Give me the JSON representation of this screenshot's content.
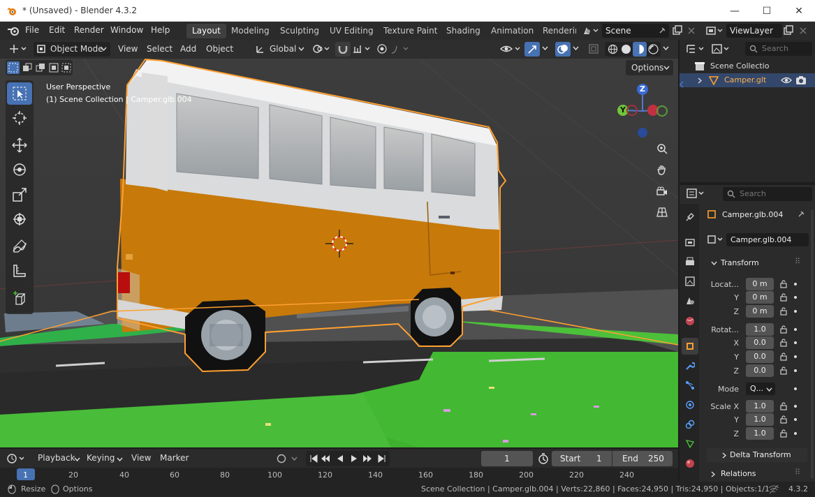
{
  "window": {
    "title": "* (Unsaved) - Blender 4.3.2",
    "minimize": "—",
    "maximize": "☐",
    "close": "✕"
  },
  "menu": [
    "File",
    "Edit",
    "Render",
    "Window",
    "Help"
  ],
  "workspaces": [
    "Layout",
    "Modeling",
    "Sculpting",
    "UV Editing",
    "Texture Paint",
    "Shading",
    "Animation",
    "Renderir"
  ],
  "scene": "Scene",
  "viewlayer": "ViewLayer",
  "header": {
    "mode": "Object Mode",
    "view": "View",
    "select": "Select",
    "add": "Add",
    "object": "Object",
    "orientation": "Global",
    "options": "Options"
  },
  "viewport": {
    "perspective": "User Perspective",
    "collection": "(1) Scene Collection | Camper.glb.004",
    "axis_x": "",
    "axis_y": "Y",
    "axis_z": "Z"
  },
  "outliner": {
    "search": "Search",
    "root": "Scene Collectio",
    "item": "Camper.glt"
  },
  "properties": {
    "search": "Search",
    "object_name": "Camper.glb.004",
    "data_name": "Camper.glb.004",
    "transform": "Transform",
    "location_label": "Locat...",
    "loc_x": "0 m",
    "loc_y": "0 m",
    "loc_z": "0 m",
    "rotation_label": "Rotat...",
    "rot_w": "1.0",
    "rot_x": "0.0",
    "rot_y": "0.0",
    "rot_z": "0.0",
    "mode_label": "Mode",
    "mode_value": "Q...",
    "scale_label": "Scale X",
    "scale_x": "1.0",
    "scale_y": "1.0",
    "scale_z": "1.0",
    "y": "Y",
    "z": "Z",
    "x": "X",
    "delta": "Delta Transform",
    "relations": "Relations"
  },
  "timeline": {
    "playback": "Playback",
    "keying": "Keying",
    "view": "View",
    "marker": "Marker",
    "current": "1",
    "start_label": "Start",
    "start": "1",
    "end_label": "End",
    "end": "250",
    "ticks": [
      "1",
      "20",
      "40",
      "60",
      "80",
      "100",
      "120",
      "140",
      "160",
      "180",
      "200",
      "220",
      "240"
    ]
  },
  "status": {
    "resize": "Resize",
    "options": "Options",
    "info": "Scene Collection | Camper.glb.004 | Verts:22,860 | Faces:24,950 | Tris:24,950 | Objects:1/1",
    "version": "4.3.2"
  },
  "colors": {
    "accent": "#4772b3",
    "selection": "#ffa030",
    "van_orange": "#c7790a",
    "grass": "#4cc03a"
  }
}
